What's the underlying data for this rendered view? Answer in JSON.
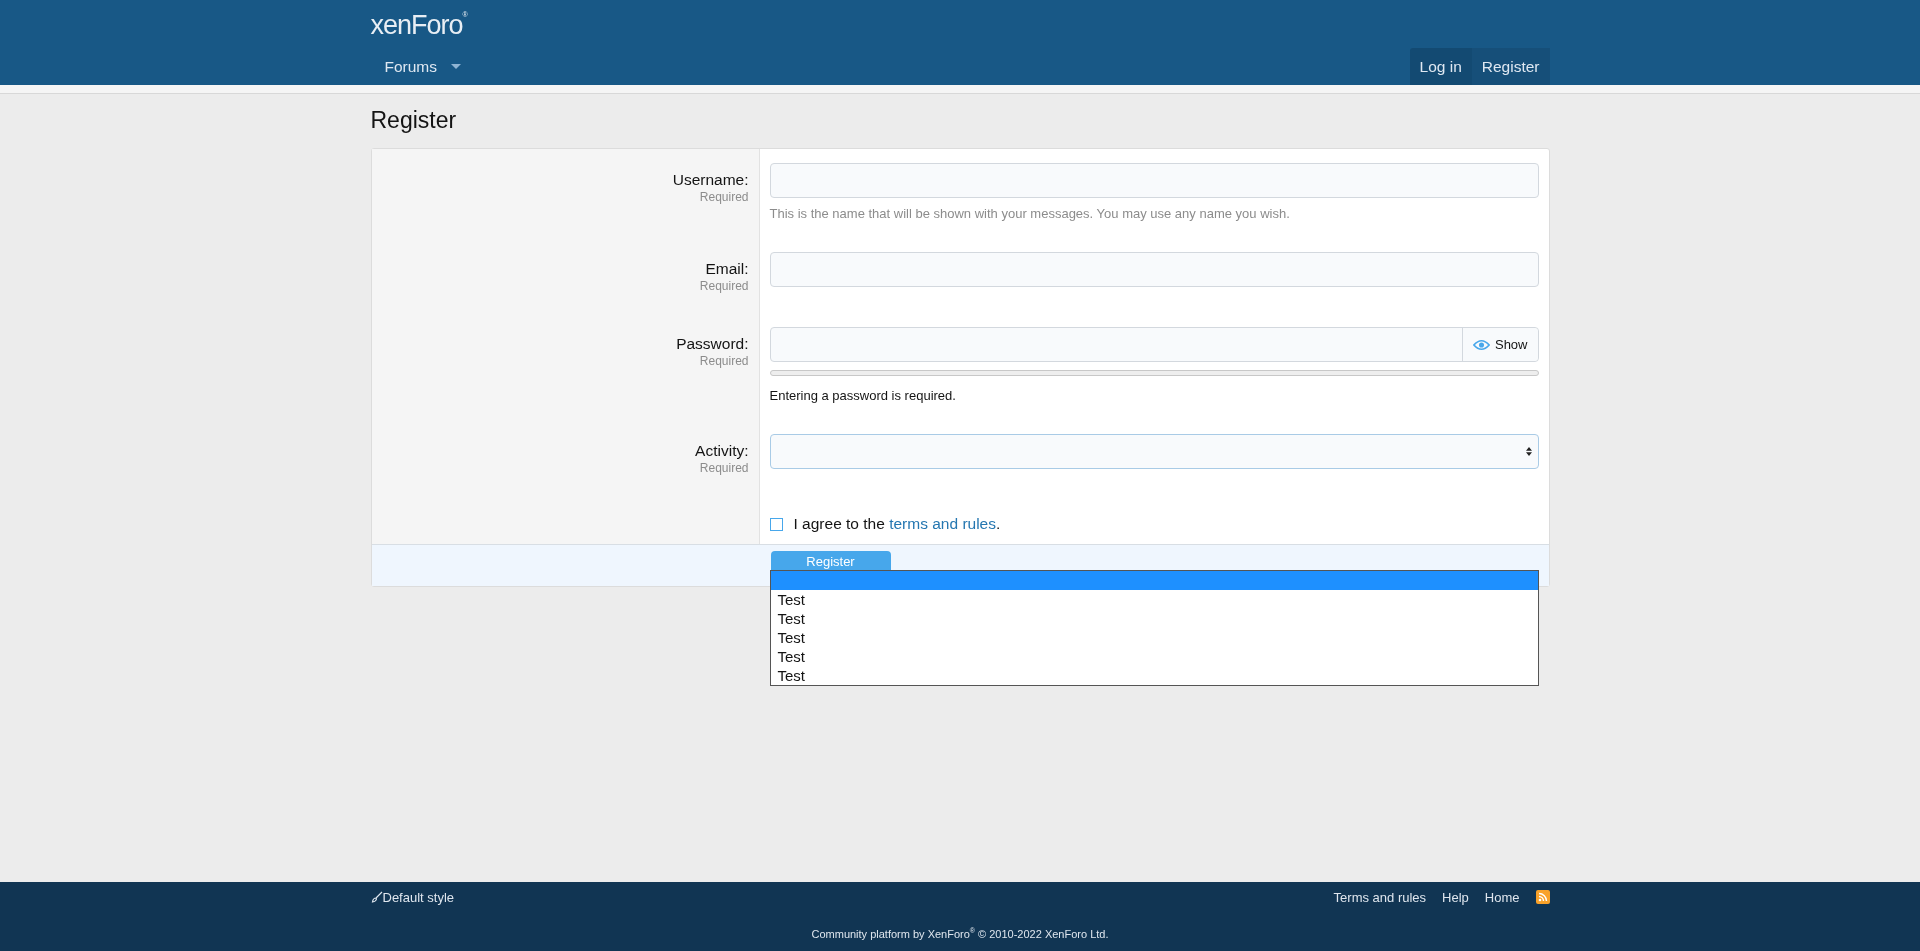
{
  "header": {
    "logo": "xenForo$^{®}$",
    "nav": [
      {
        "label": "Forums",
        "selected": false
      }
    ],
    "account_links": [
      "Log in",
      "Register"
    ]
  },
  "page_title": "Register",
  "form": {
    "fields": [
      {
        "kind": "text",
        "label": "Username:",
        "required": "Required",
        "hint": "This is the name that will be shown with your messages. You may use any name you wish."
      },
      {
        "kind": "text",
        "label": "Email:",
        "required": "Required"
      },
      {
        "kind": "password",
        "label": "Password:",
        "required": "Required",
        "show_label": "Show",
        "strength": {
          "level": 0
        },
        "message": "Entering a password is required."
      },
      {
        "kind": "select",
        "label": "Activity:",
        "required": "Required"
      }
    ],
    "agree": {
      "checked": false,
      "text": "I agree to the ",
      "link": "terms and rules",
      "after": "."
    },
    "submit": "Register",
    "open_list": [
      {
        "selected": true
      },
      {
        "label": "Test",
        "selected": false
      },
      {
        "label": "Test",
        "selected": false
      },
      {
        "label": "Test",
        "selected": false
      },
      {
        "label": "Test",
        "selected": false
      },
      {
        "label": "Test",
        "selected": false
      }
    ]
  },
  "footer": {
    "style_link": "Default style",
    "links": [
      "Terms and rules",
      "Help",
      "Home"
    ],
    "copyright": "Community platform by XenForo$^{®}$ © 2010-2022 XenForo Ltd."
  }
}
